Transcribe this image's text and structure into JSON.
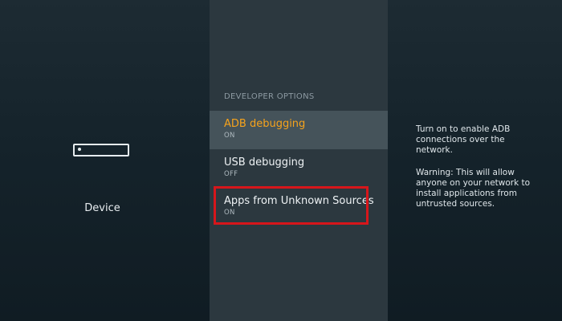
{
  "left_pane": {
    "icon": "tv-device-icon",
    "label": "Device"
  },
  "menu": {
    "heading": "DEVELOPER OPTIONS",
    "items": [
      {
        "title": "ADB debugging",
        "state": "ON",
        "selected": true
      },
      {
        "title": "USB debugging",
        "state": "OFF",
        "selected": false
      },
      {
        "title": "Apps from Unknown Sources",
        "state": "ON",
        "selected": false
      }
    ]
  },
  "description": {
    "line1": "Turn on to enable ADB connections over the network.",
    "line2": "Warning: This will allow anyone on your network to install applications from untrusted sources."
  },
  "colors": {
    "selected_text": "#f6a31c",
    "highlight_border": "#d7161b",
    "middle_pane_bg": "#2c383f",
    "selected_row_bg": "#45535a"
  }
}
